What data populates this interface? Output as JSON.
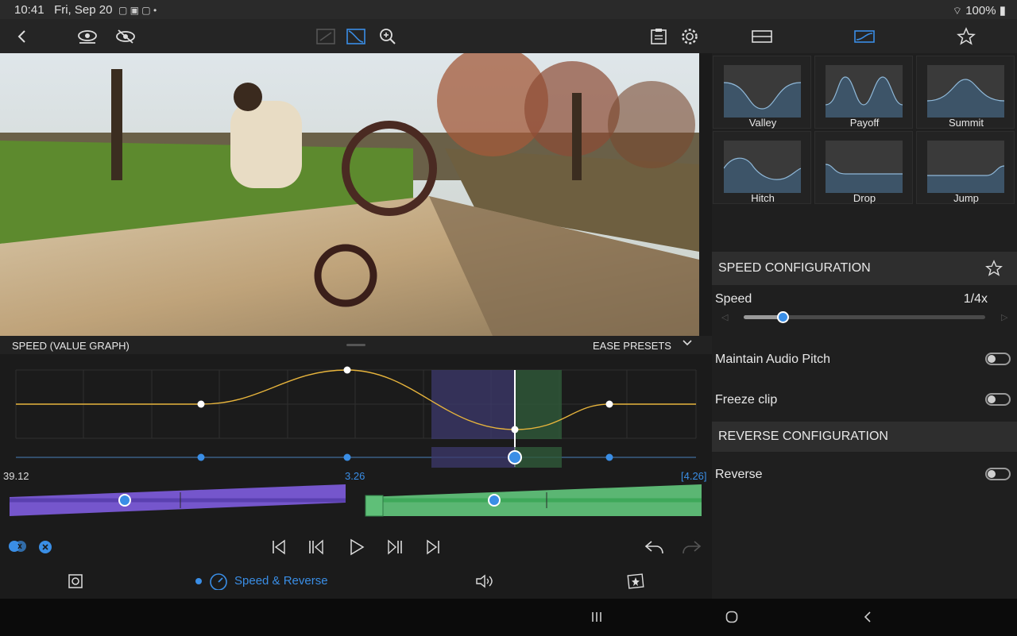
{
  "status": {
    "time": "10:41",
    "date": "Fri, Sep 20",
    "battery": "100%"
  },
  "toolbar": {
    "icons": [
      "back-icon",
      "eye-icon",
      "eye-slash-icon",
      "crop-icon",
      "curve-icon",
      "zoom-icon",
      "clipboard-icon",
      "gear-icon",
      "layout-icon",
      "graph-icon",
      "star-icon"
    ]
  },
  "presets": [
    {
      "label": "Valley"
    },
    {
      "label": "Payoff"
    },
    {
      "label": "Summit"
    },
    {
      "label": "Hitch"
    },
    {
      "label": "Drop"
    },
    {
      "label": "Jump"
    }
  ],
  "speed_config": {
    "title": "SPEED CONFIGURATION",
    "speed_label": "Speed",
    "speed_value": "1/4x",
    "speed_slider_fraction": 0.16,
    "maintain_pitch_label": "Maintain Audio Pitch",
    "maintain_pitch_on": false,
    "freeze_label": "Freeze clip",
    "freeze_on": false
  },
  "reverse_config": {
    "title": "REVERSE CONFIGURATION",
    "reverse_label": "Reverse",
    "reverse_on": false
  },
  "graph": {
    "title": "SPEED (VALUE GRAPH)",
    "presets_label": "EASE PRESETS",
    "left_time": "39.12",
    "mid_time": "3.26",
    "right_time": "[4.26]"
  },
  "tabs": {
    "speed_reverse": "Speed & Reverse"
  },
  "colors": {
    "accent": "#3a8ee6",
    "curve": "#e7b43c",
    "purple": "#7a5ad6",
    "green": "#5fbf78"
  }
}
